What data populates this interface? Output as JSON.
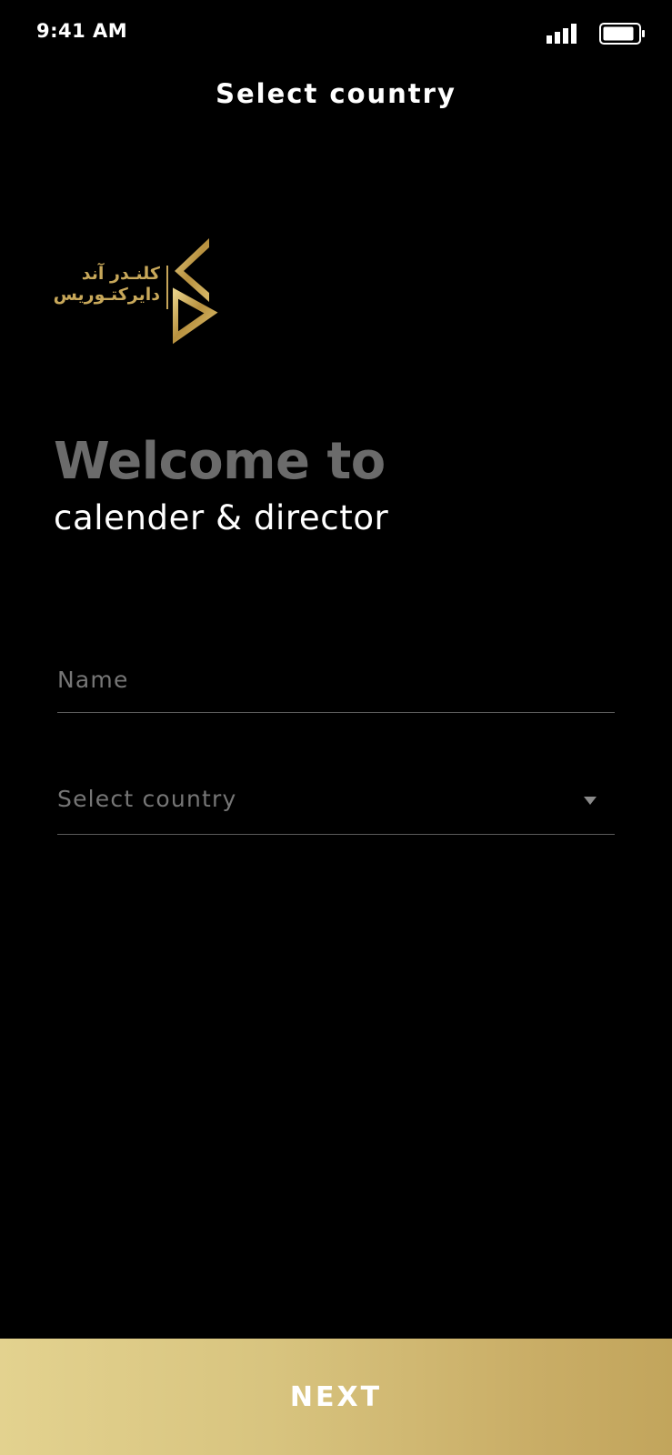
{
  "status_bar": {
    "time": "9:41 AM",
    "icons": [
      "signal-icon",
      "battery-icon"
    ]
  },
  "header": {
    "title": "Select country"
  },
  "logo": {
    "arabic_line1": "كلنـدر آند",
    "arabic_line2": "دايركتـوريس",
    "brand_color": "#c6a55a"
  },
  "welcome": {
    "title": "Welcome to",
    "subtitle": "calender & director"
  },
  "form": {
    "name_placeholder": "Name",
    "country_placeholder": "Select country"
  },
  "footer": {
    "next_label": "NEXT"
  },
  "colors": {
    "background": "#000000",
    "title_grey": "#6b6b6b",
    "placeholder": "#767676",
    "gold_start": "#e3d28f",
    "gold_end": "#c2a55c"
  }
}
